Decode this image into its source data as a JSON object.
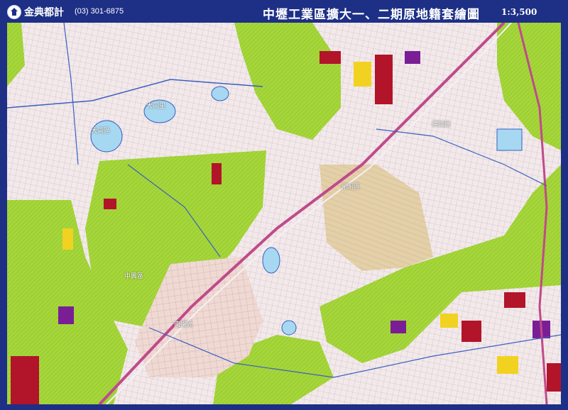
{
  "header": {
    "brand": "金典都計",
    "phone": "(03) 301-6875",
    "title": "中壢工業區擴大一、二期原地籍套繪圖",
    "scale": "1:3,500"
  },
  "map": {
    "place_labels": [
      {
        "name": "label-daxing-pond",
        "text": "大同區"
      },
      {
        "name": "label-neighborhood-north",
        "text": "大同里"
      },
      {
        "name": "label-central-zone",
        "text": "中興區"
      },
      {
        "name": "label-east-zone",
        "text": "光明區"
      },
      {
        "name": "label-northeast-zone",
        "text": "德國區"
      },
      {
        "name": "label-south-zone",
        "text": "南園區"
      }
    ],
    "colors": {
      "green_zone": "#a5d63a",
      "residential": "#f3e9ea",
      "red_block": "#b2142a",
      "yellow_block": "#f2d221",
      "purple_block": "#7a1e96",
      "water": "#a6d8f2",
      "road": "#3b5fc1",
      "rail": "#c04a8a",
      "tan_block": "#e3cfa8"
    }
  }
}
